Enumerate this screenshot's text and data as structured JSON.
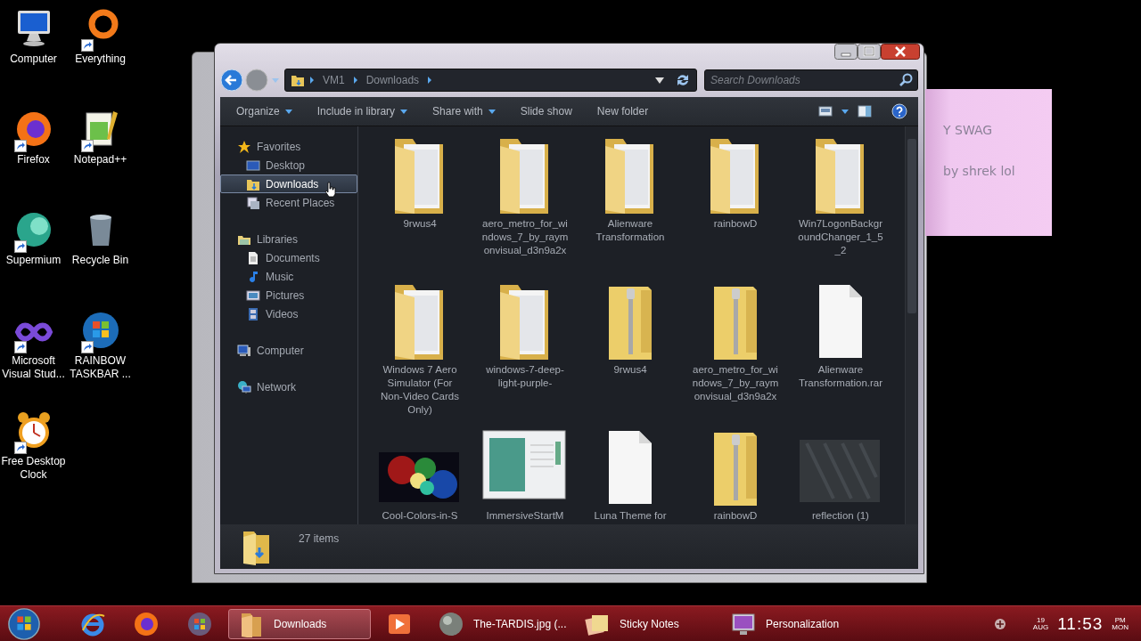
{
  "desktop_icons": [
    {
      "label": "Computer",
      "kind": "computer",
      "shortcut": false
    },
    {
      "label": "Everything",
      "kind": "ring",
      "shortcut": true
    },
    {
      "label": "Firefox",
      "kind": "firefox",
      "shortcut": true
    },
    {
      "label": "Notepad++",
      "kind": "notepad",
      "shortcut": true
    },
    {
      "label": "Supermium",
      "kind": "globe",
      "shortcut": true
    },
    {
      "label": "Recycle Bin",
      "kind": "bin",
      "shortcut": false
    },
    {
      "label": "Microsoft Visual Stud...",
      "kind": "infinity",
      "shortcut": true
    },
    {
      "label": "RAINBOW TASKBAR ...",
      "kind": "orb",
      "shortcut": true
    },
    {
      "label": "Free Desktop Clock",
      "kind": "clock",
      "shortcut": true
    }
  ],
  "sticky_note": {
    "lines": [
      "Y SWAG",
      "by shrek lol"
    ]
  },
  "explorer": {
    "address": {
      "path": [
        "VM1",
        "Downloads"
      ]
    },
    "search": {
      "placeholder": "Search Downloads"
    },
    "toolbar": [
      {
        "label": "Organize",
        "dropdown": true
      },
      {
        "label": "Include in library",
        "dropdown": true
      },
      {
        "label": "Share with",
        "dropdown": true
      },
      {
        "label": "Slide show",
        "dropdown": false
      },
      {
        "label": "New folder",
        "dropdown": false
      }
    ],
    "navigation": [
      {
        "label": "Favorites",
        "kind": "star",
        "selected": false,
        "children": [
          {
            "label": "Desktop",
            "kind": "desktop",
            "selected": false
          },
          {
            "label": "Downloads",
            "kind": "downloads",
            "selected": true
          },
          {
            "label": "Recent Places",
            "kind": "recent",
            "selected": false
          }
        ]
      },
      {
        "label": "Libraries",
        "kind": "library",
        "selected": false,
        "children": [
          {
            "label": "Documents",
            "kind": "documents",
            "selected": false
          },
          {
            "label": "Music",
            "kind": "music",
            "selected": false
          },
          {
            "label": "Pictures",
            "kind": "pictures",
            "selected": false
          },
          {
            "label": "Videos",
            "kind": "videos",
            "selected": false
          }
        ]
      },
      {
        "label": "Computer",
        "kind": "computer",
        "selected": false
      },
      {
        "label": "Network",
        "kind": "network",
        "selected": false
      }
    ],
    "items": [
      {
        "name": "9rwus4",
        "kind": "folder"
      },
      {
        "name": "aero_metro_for_windows_7_by_raymonvisual_d3n9a2x",
        "kind": "folder"
      },
      {
        "name": "Alienware Transformation",
        "kind": "folder"
      },
      {
        "name": "rainbowD",
        "kind": "folder"
      },
      {
        "name": "Win7LogonBackgroundChanger_1_5_2",
        "kind": "folder"
      },
      {
        "name": "Windows 7 Aero Simulator (For Non-Video Cards Only)",
        "kind": "folder"
      },
      {
        "name": "windows-7-deep-light-purple-",
        "kind": "folder"
      },
      {
        "name": "9rwus4",
        "kind": "zip"
      },
      {
        "name": "aero_metro_for_windows_7_by_raymonvisual_d3n9a2x",
        "kind": "zip"
      },
      {
        "name": "Alienware Transformation.rar",
        "kind": "file"
      },
      {
        "name": "Cool-Colors-in-S",
        "kind": "image"
      },
      {
        "name": "ImmersiveStartM",
        "kind": "screenshot"
      },
      {
        "name": "Luna Theme for",
        "kind": "file"
      },
      {
        "name": "rainbowD",
        "kind": "zip"
      },
      {
        "name": "reflection (1)",
        "kind": "texture"
      }
    ],
    "status": {
      "count": "27 items"
    }
  },
  "taskbar": {
    "items": [
      {
        "kind": "pinned",
        "selected": false
      },
      {
        "kind": "pinned",
        "selected": false
      },
      {
        "kind": "pinned",
        "selected": false
      },
      {
        "kind": "window",
        "label": "Downloads",
        "selected": true
      },
      {
        "kind": "pinned",
        "selected": false
      },
      {
        "kind": "window",
        "label": "The-TARDIS.jpg (...",
        "selected": false
      },
      {
        "kind": "window",
        "label": "Sticky Notes",
        "selected": false
      },
      {
        "kind": "window",
        "label": "Personalization",
        "selected": false
      }
    ],
    "clock": {
      "day": "19",
      "month": "AUG",
      "time": "11:53",
      "ampm": "PM",
      "weekday": "MON"
    }
  }
}
